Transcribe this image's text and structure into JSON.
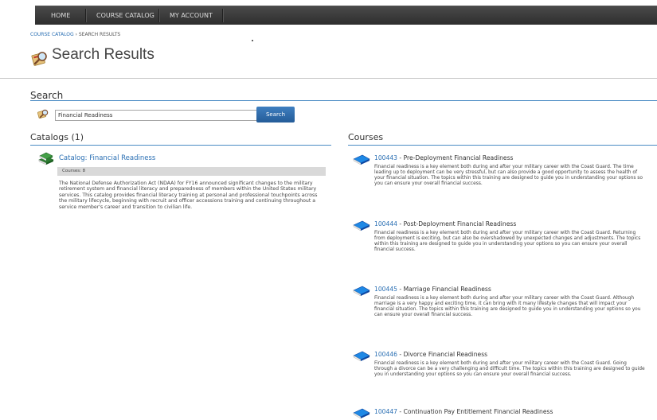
{
  "nav": {
    "items": [
      {
        "label": "HOME"
      },
      {
        "label": "COURSE CATALOG"
      },
      {
        "label": "MY ACCOUNT"
      }
    ]
  },
  "breadcrumb": {
    "link": "COURSE CATALOG",
    "separator": " › ",
    "current": "SEARCH RESULTS"
  },
  "page": {
    "title": "Search Results"
  },
  "search": {
    "heading": "Search",
    "value": "Financial Readiness",
    "button_label": "Search"
  },
  "catalogs": {
    "heading": "Catalogs (1)",
    "items": [
      {
        "title": "Catalog: Financial Readiness",
        "count": "Courses: 8",
        "description": "The National Defense Authorization Act (NDAA) for FY16 announced significant changes to the military retirement system and financial literacy and preparedness of members within the United States military services. This catalog provides financial literacy training at personal and professional touchpoints across the military lifecycle, beginning with recruit and officer accessions training and continuing throughout a service member's career and transition to civilian life."
      }
    ]
  },
  "courses": {
    "heading": "Courses",
    "items": [
      {
        "code": "100443",
        "title": " - Pre-Deployment Financial Readiness",
        "description": "Financial readiness is a key element both during and after your military career with the Coast Guard. The time leading up to deployment can be very stressful, but can also provide a good opportunity to assess the health of your financial situation. The topics within this training are designed to guide you in understanding your options so you can ensure your overall financial success."
      },
      {
        "code": "100444",
        "title": " - Post-Deployment Financial Readiness",
        "description": "Financial readiness is a key element both during and after your military career with the Coast Guard. Returning from deployment is exciting, but can also be overshadowed by unexpected changes and adjustments. The topics within this training are designed to guide you in understanding your options so you can ensure your overall financial success."
      },
      {
        "code": "100445",
        "title": " - Marriage Financial Readiness",
        "description": "Financial readiness is a key element both during and after your military career with the Coast Guard. Although marriage is a very happy and exciting time, it can bring with it many lifestyle changes that will impact your financial situation. The topics within this training are designed to guide you in understanding your options so you can ensure your overall financial success."
      },
      {
        "code": "100446",
        "title": " - Divorce Financial Readiness",
        "description": "Financial readiness is a key element both during and after your military career with the Coast Guard. Going through a divorce can be a very challenging and difficult time. The topics within this training are designed to guide you in understanding your options so you can ensure your overall financial success."
      },
      {
        "code": "100447",
        "title": " - Continuation Pay Entitlement Financial Readiness",
        "description": ""
      }
    ]
  },
  "colors": {
    "link": "#2a6fb3",
    "nav_bg": "#3a3a3a",
    "rule": "#4a8bc4",
    "button": "#2f6eab"
  },
  "icons": {
    "page_title": "search-magnifier-icon",
    "catalog": "book-stack-icon",
    "course": "blue-book-icon"
  }
}
